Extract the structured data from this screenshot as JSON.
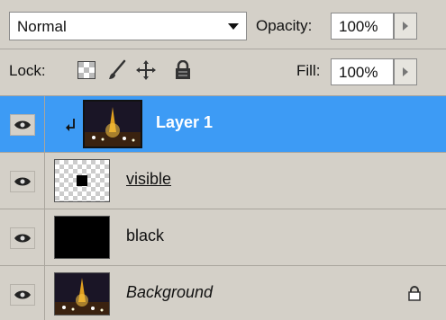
{
  "top": {
    "blend_mode": "Normal",
    "opacity_label": "Opacity:",
    "opacity_value": "100%"
  },
  "lock": {
    "label": "Lock:",
    "fill_label": "Fill:",
    "fill_value": "100%"
  },
  "layers": [
    {
      "name": "Layer 1",
      "selected": true,
      "clipped": true
    },
    {
      "name": "visible",
      "selected": false
    },
    {
      "name": "black",
      "selected": false
    },
    {
      "name": "Background",
      "selected": false,
      "locked": true
    }
  ],
  "icons": {
    "dropdown": "chevron-down-icon",
    "step": "triangle-right-icon",
    "lock_transparent": "checkerboard-icon",
    "lock_image": "brush-icon",
    "lock_position": "move-icon",
    "lock_all": "lock-icon",
    "visibility": "eye-icon",
    "clip": "clip-arrow-icon"
  }
}
